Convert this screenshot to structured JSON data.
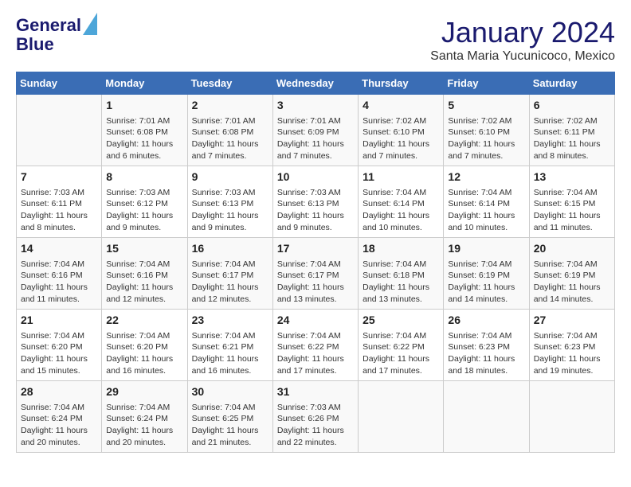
{
  "logo": {
    "line1": "General",
    "line2": "Blue"
  },
  "title": "January 2024",
  "subtitle": "Santa Maria Yucunicoco, Mexico",
  "headers": [
    "Sunday",
    "Monday",
    "Tuesday",
    "Wednesday",
    "Thursday",
    "Friday",
    "Saturday"
  ],
  "weeks": [
    [
      {
        "day": "",
        "info": ""
      },
      {
        "day": "1",
        "info": "Sunrise: 7:01 AM\nSunset: 6:08 PM\nDaylight: 11 hours\nand 6 minutes."
      },
      {
        "day": "2",
        "info": "Sunrise: 7:01 AM\nSunset: 6:08 PM\nDaylight: 11 hours\nand 7 minutes."
      },
      {
        "day": "3",
        "info": "Sunrise: 7:01 AM\nSunset: 6:09 PM\nDaylight: 11 hours\nand 7 minutes."
      },
      {
        "day": "4",
        "info": "Sunrise: 7:02 AM\nSunset: 6:10 PM\nDaylight: 11 hours\nand 7 minutes."
      },
      {
        "day": "5",
        "info": "Sunrise: 7:02 AM\nSunset: 6:10 PM\nDaylight: 11 hours\nand 7 minutes."
      },
      {
        "day": "6",
        "info": "Sunrise: 7:02 AM\nSunset: 6:11 PM\nDaylight: 11 hours\nand 8 minutes."
      }
    ],
    [
      {
        "day": "7",
        "info": "Sunrise: 7:03 AM\nSunset: 6:11 PM\nDaylight: 11 hours\nand 8 minutes."
      },
      {
        "day": "8",
        "info": "Sunrise: 7:03 AM\nSunset: 6:12 PM\nDaylight: 11 hours\nand 9 minutes."
      },
      {
        "day": "9",
        "info": "Sunrise: 7:03 AM\nSunset: 6:13 PM\nDaylight: 11 hours\nand 9 minutes."
      },
      {
        "day": "10",
        "info": "Sunrise: 7:03 AM\nSunset: 6:13 PM\nDaylight: 11 hours\nand 9 minutes."
      },
      {
        "day": "11",
        "info": "Sunrise: 7:04 AM\nSunset: 6:14 PM\nDaylight: 11 hours\nand 10 minutes."
      },
      {
        "day": "12",
        "info": "Sunrise: 7:04 AM\nSunset: 6:14 PM\nDaylight: 11 hours\nand 10 minutes."
      },
      {
        "day": "13",
        "info": "Sunrise: 7:04 AM\nSunset: 6:15 PM\nDaylight: 11 hours\nand 11 minutes."
      }
    ],
    [
      {
        "day": "14",
        "info": "Sunrise: 7:04 AM\nSunset: 6:16 PM\nDaylight: 11 hours\nand 11 minutes."
      },
      {
        "day": "15",
        "info": "Sunrise: 7:04 AM\nSunset: 6:16 PM\nDaylight: 11 hours\nand 12 minutes."
      },
      {
        "day": "16",
        "info": "Sunrise: 7:04 AM\nSunset: 6:17 PM\nDaylight: 11 hours\nand 12 minutes."
      },
      {
        "day": "17",
        "info": "Sunrise: 7:04 AM\nSunset: 6:17 PM\nDaylight: 11 hours\nand 13 minutes."
      },
      {
        "day": "18",
        "info": "Sunrise: 7:04 AM\nSunset: 6:18 PM\nDaylight: 11 hours\nand 13 minutes."
      },
      {
        "day": "19",
        "info": "Sunrise: 7:04 AM\nSunset: 6:19 PM\nDaylight: 11 hours\nand 14 minutes."
      },
      {
        "day": "20",
        "info": "Sunrise: 7:04 AM\nSunset: 6:19 PM\nDaylight: 11 hours\nand 14 minutes."
      }
    ],
    [
      {
        "day": "21",
        "info": "Sunrise: 7:04 AM\nSunset: 6:20 PM\nDaylight: 11 hours\nand 15 minutes."
      },
      {
        "day": "22",
        "info": "Sunrise: 7:04 AM\nSunset: 6:20 PM\nDaylight: 11 hours\nand 16 minutes."
      },
      {
        "day": "23",
        "info": "Sunrise: 7:04 AM\nSunset: 6:21 PM\nDaylight: 11 hours\nand 16 minutes."
      },
      {
        "day": "24",
        "info": "Sunrise: 7:04 AM\nSunset: 6:22 PM\nDaylight: 11 hours\nand 17 minutes."
      },
      {
        "day": "25",
        "info": "Sunrise: 7:04 AM\nSunset: 6:22 PM\nDaylight: 11 hours\nand 17 minutes."
      },
      {
        "day": "26",
        "info": "Sunrise: 7:04 AM\nSunset: 6:23 PM\nDaylight: 11 hours\nand 18 minutes."
      },
      {
        "day": "27",
        "info": "Sunrise: 7:04 AM\nSunset: 6:23 PM\nDaylight: 11 hours\nand 19 minutes."
      }
    ],
    [
      {
        "day": "28",
        "info": "Sunrise: 7:04 AM\nSunset: 6:24 PM\nDaylight: 11 hours\nand 20 minutes."
      },
      {
        "day": "29",
        "info": "Sunrise: 7:04 AM\nSunset: 6:24 PM\nDaylight: 11 hours\nand 20 minutes."
      },
      {
        "day": "30",
        "info": "Sunrise: 7:04 AM\nSunset: 6:25 PM\nDaylight: 11 hours\nand 21 minutes."
      },
      {
        "day": "31",
        "info": "Sunrise: 7:03 AM\nSunset: 6:26 PM\nDaylight: 11 hours\nand 22 minutes."
      },
      {
        "day": "",
        "info": ""
      },
      {
        "day": "",
        "info": ""
      },
      {
        "day": "",
        "info": ""
      }
    ]
  ]
}
